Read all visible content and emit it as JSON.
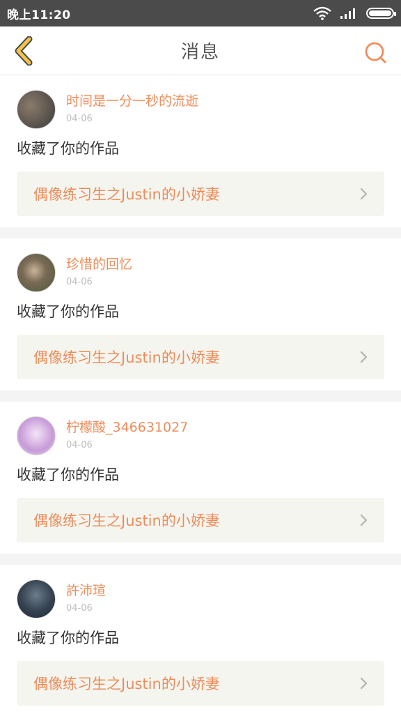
{
  "status_bar": {
    "time": "晚上11:20"
  },
  "header": {
    "title": "消息",
    "back_icon": "chevron-left-icon",
    "search_icon": "search-icon"
  },
  "colors": {
    "accent": "#ef8c5a",
    "back_icon": "#f2c24a",
    "link_bg": "#f5f5ef"
  },
  "messages": [
    {
      "username": "时间是一分一秒的流逝",
      "date": "04-06",
      "action": "收藏了你的作品",
      "work_title": "偶像练习生之Justin的小娇妻",
      "avatar_colors": [
        "#3a3a3a",
        "#8a7b6a"
      ]
    },
    {
      "username": "珍惜的回忆",
      "date": "04-06",
      "action": "收藏了你的作品",
      "work_title": "偶像练习生之Justin的小娇妻",
      "avatar_colors": [
        "#4a5a3a",
        "#c9b49a"
      ]
    },
    {
      "username": "柠檬酸_346631027",
      "date": "04-06",
      "action": "收藏了你的作品",
      "work_title": "偶像练习生之Justin的小娇妻",
      "avatar_colors": [
        "#e6d9f2",
        "#c79ad8"
      ]
    },
    {
      "username": "許沛瑄",
      "date": "04-06",
      "action": "收藏了你的作品",
      "work_title": "偶像练习生之Justin的小娇妻",
      "avatar_colors": [
        "#1f2b3a",
        "#6b7c8c"
      ]
    }
  ]
}
